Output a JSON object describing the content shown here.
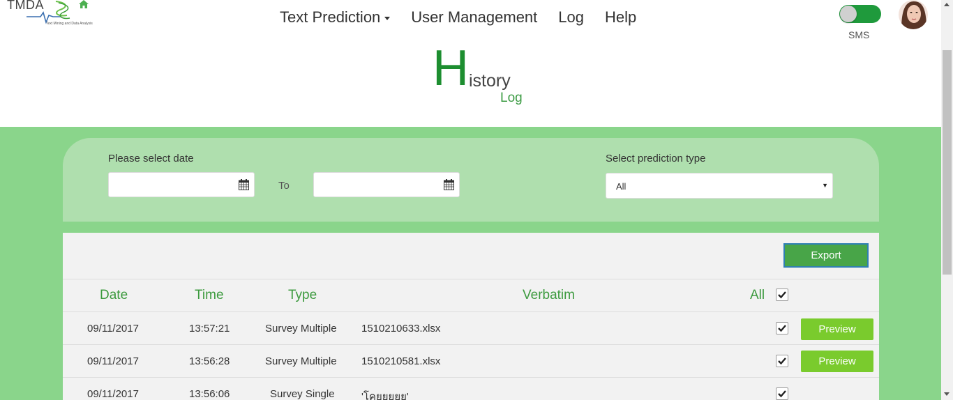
{
  "app": {
    "logo_text": "TMDA",
    "logo_tagline": "Text Mining and Data Analysis"
  },
  "nav": {
    "items": [
      {
        "label": "Text Prediction",
        "dropdown": true
      },
      {
        "label": "User Management"
      },
      {
        "label": "Log"
      },
      {
        "label": "Help"
      }
    ]
  },
  "header": {
    "sms_label": "SMS",
    "sms_toggle_on": true
  },
  "title": {
    "initial": "H",
    "rest": "istory",
    "subtitle": "Log"
  },
  "filters": {
    "date_label": "Please select date",
    "from_value": "",
    "to_label": "To",
    "to_value": "",
    "type_label": "Select prediction type",
    "type_selected": "All"
  },
  "table": {
    "export_label": "Export",
    "columns": {
      "date": "Date",
      "time": "Time",
      "type": "Type",
      "verbatim": "Verbatim",
      "all": "All"
    },
    "all_checked": true,
    "rows": [
      {
        "date": "09/11/2017",
        "time": "13:57:21",
        "type": "Survey Multiple",
        "verbatim": "1510210633.xlsx",
        "checked": true,
        "action": "Preview"
      },
      {
        "date": "09/11/2017",
        "time": "13:56:28",
        "type": "Survey Multiple",
        "verbatim": "1510210581.xlsx",
        "checked": true,
        "action": "Preview"
      },
      {
        "date": "09/11/2017",
        "time": "13:56:06",
        "type": "Survey Single",
        "verbatim": "'โคยยยยย'",
        "checked": true,
        "action": ""
      }
    ]
  },
  "colors": {
    "brand_green": "#1d8e30",
    "band_green": "#8ad58b",
    "panel_green": "#afdfae",
    "preview_green": "#7acb2d",
    "export_green": "#48a548"
  }
}
